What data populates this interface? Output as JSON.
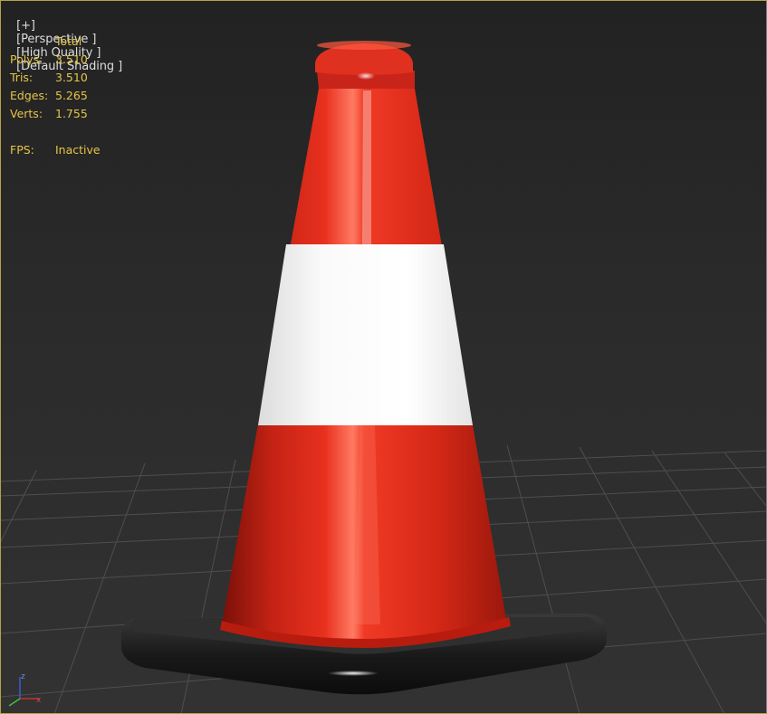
{
  "viewport": {
    "labels": [
      "[+]",
      "[Perspective ]",
      "[High Quality ]",
      "[Default Shading ]"
    ]
  },
  "stats": {
    "header": "Total",
    "rows": [
      {
        "key": "Polys:",
        "value": "3.510"
      },
      {
        "key": "Tris:",
        "value": "3.510"
      },
      {
        "key": "Edges:",
        "value": "5.265"
      },
      {
        "key": "Verts:",
        "value": "1.755"
      }
    ],
    "fps": {
      "key": "FPS:",
      "value": "Inactive"
    }
  },
  "axis": {
    "z_label": "z",
    "x_label": "x"
  },
  "colors": {
    "stats_text": "#e6c547",
    "label_text": "#dcdcdc",
    "cone_red": "#e0291c",
    "band_white": "#f2f2f2",
    "base_black": "#151515",
    "grid": "#555555",
    "active_border": "#b9a246"
  }
}
